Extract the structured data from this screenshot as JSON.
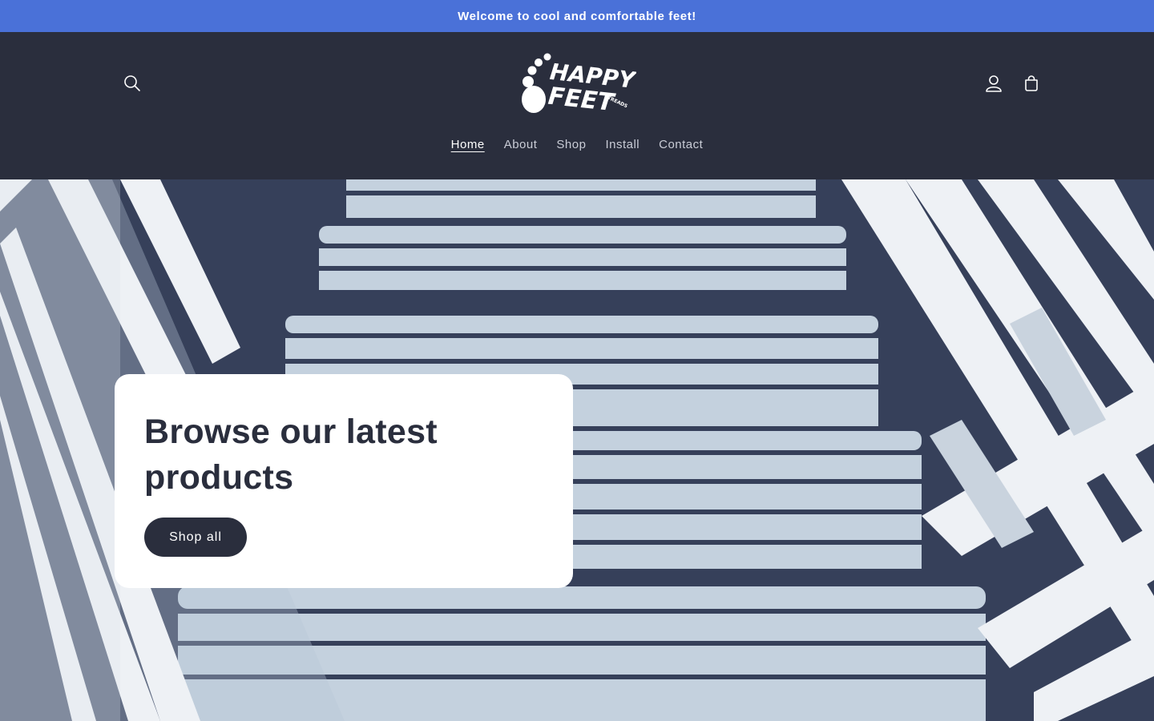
{
  "announcement": {
    "text": "Welcome to cool and comfortable feet!"
  },
  "header": {
    "logo": {
      "line1": "HAPPY",
      "line2": "FEET",
      "tag": "TREADS"
    },
    "icons": {
      "search": "search-icon",
      "account": "user-icon",
      "cart": "cart-icon"
    }
  },
  "nav": {
    "items": [
      {
        "label": "Home",
        "active": true
      },
      {
        "label": "About"
      },
      {
        "label": "Shop"
      },
      {
        "label": "Install"
      },
      {
        "label": "Contact"
      }
    ]
  },
  "hero": {
    "title": "Browse our latest products",
    "button_label": "Shop all"
  },
  "colors": {
    "announcement_bg": "#4a71d8",
    "header_bg": "#2a2e3d",
    "button_bg": "#2a2e3d",
    "card_bg": "#ffffff"
  }
}
